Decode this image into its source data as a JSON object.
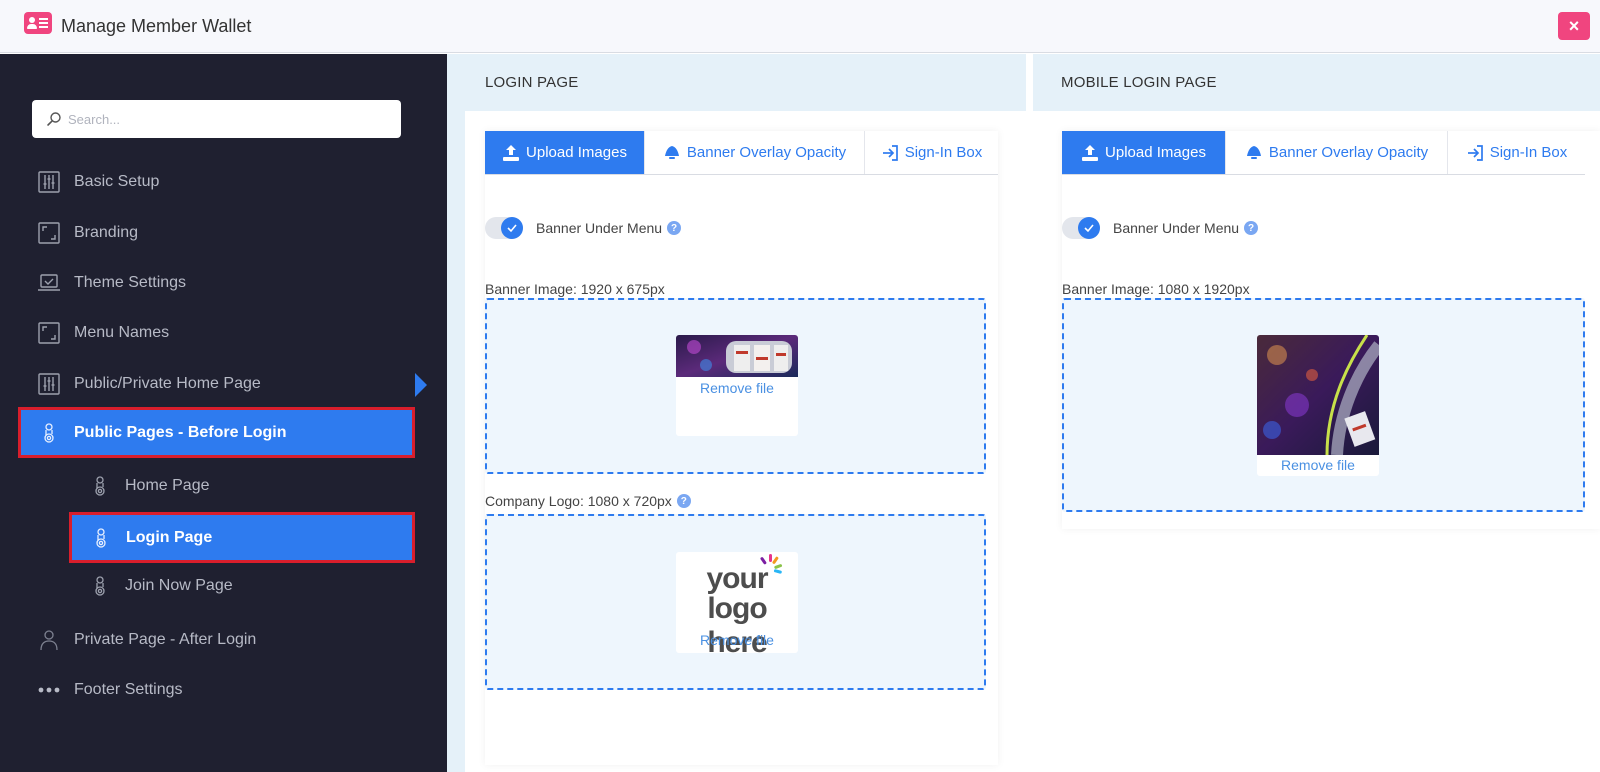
{
  "app": {
    "title": "Manage Member Wallet",
    "close_label": "×"
  },
  "sidebar": {
    "search_placeholder": "Search...",
    "items": [
      {
        "label": "Basic Setup",
        "icon": "sliders-icon"
      },
      {
        "label": "Branding",
        "icon": "frame-icon"
      },
      {
        "label": "Theme Settings",
        "icon": "laptop-icon"
      },
      {
        "label": "Menu Names",
        "icon": "frame-icon"
      },
      {
        "label": "Public/Private Home Page",
        "icon": "sliders-icon"
      },
      {
        "label": "Public Pages - Before Login",
        "icon": "fingerprint-icon",
        "active": true
      },
      {
        "label": "Home Page",
        "icon": "fingerprint-icon",
        "sub": true
      },
      {
        "label": "Login Page",
        "icon": "fingerprint-icon",
        "sub": true,
        "active": true
      },
      {
        "label": "Join Now Page",
        "icon": "fingerprint-icon",
        "sub": true
      },
      {
        "label": "Private Page - After Login",
        "icon": "user-icon"
      },
      {
        "label": "Footer Settings",
        "icon": "dots-icon"
      }
    ]
  },
  "login_panel": {
    "title": "LOGIN PAGE",
    "tabs": [
      {
        "label": "Upload Images",
        "icon": "upload-icon",
        "active": true
      },
      {
        "label": "Banner Overlay Opacity",
        "icon": "lamp-icon"
      },
      {
        "label": "Sign-In Box",
        "icon": "sign-in-icon"
      }
    ],
    "toggle_label": "Banner Under Menu",
    "toggle_on": true,
    "banner_label": "Banner Image: 1920 x 675px",
    "logo_label": "Company Logo: 1080 x 720px",
    "remove_label": "Remove file",
    "logo_line1": "your",
    "logo_line2": "logo here"
  },
  "mobile_panel": {
    "title": "MOBILE LOGIN PAGE",
    "tabs": [
      {
        "label": "Upload Images",
        "icon": "upload-icon",
        "active": true
      },
      {
        "label": "Banner Overlay Opacity",
        "icon": "lamp-icon"
      },
      {
        "label": "Sign-In Box",
        "icon": "sign-in-icon"
      }
    ],
    "toggle_label": "Banner Under Menu",
    "toggle_on": true,
    "banner_label": "Banner Image: 1080 x 1920px",
    "remove_label": "Remove file"
  },
  "colors": {
    "accent": "#2e7bef",
    "sidebar_bg": "#1f2030",
    "highlight_border": "#d81e2c",
    "brand_pink": "#f0457f"
  }
}
